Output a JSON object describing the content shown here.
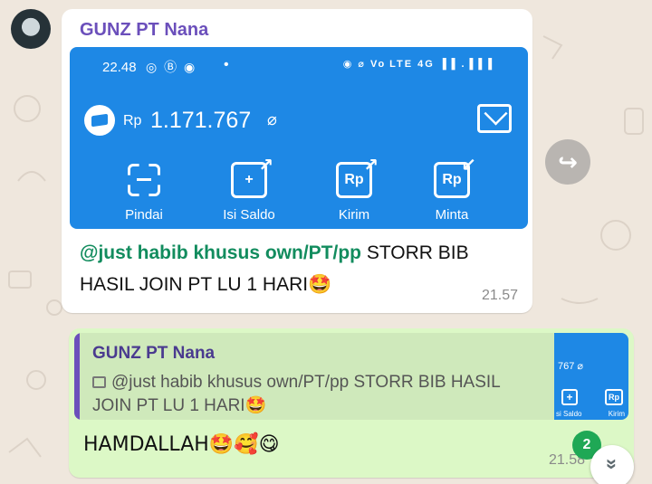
{
  "incoming": {
    "sender": "GUNZ PT Nana",
    "screenshot": {
      "status_time": "22.48",
      "status_left_icons": "◎ Ⓑ ◉",
      "status_dot": "•",
      "status_right_icons": "◉ ⌀ Vo LTE 4G ▐▐ .▐▐ ▌",
      "currency": "Rp",
      "balance": "1.171.767",
      "eye_icon": "⌀",
      "actions": [
        {
          "label": "Pindai",
          "icon": "scan-icon"
        },
        {
          "label": "Isi Saldo",
          "icon": "top-up-icon",
          "glyph": "+"
        },
        {
          "label": "Kirim",
          "icon": "send-money-icon",
          "glyph": "Rp"
        },
        {
          "label": "Minta",
          "icon": "request-money-icon",
          "glyph": "Rp"
        }
      ]
    },
    "mention": "@just habib khusus own/PT/pp",
    "caption_text": " STORR BIB HASIL JOIN PT LU 1 HARI",
    "caption_emoji": "🤩",
    "time": "21.57"
  },
  "outgoing": {
    "quote_sender": "GUNZ PT Nana",
    "quote_text": "@just habib khusus own/PT/pp STORR BIB HASIL JOIN PT LU 1 HARI🤩",
    "thumb": {
      "balance": "767 ⌀",
      "label1": "si Saldo",
      "label2": "Kirim",
      "glyph1": "+",
      "glyph2": "Rp"
    },
    "text": "HAMDALLAH🤩🥰😋",
    "time": "21.58"
  },
  "forward_glyph": "↪",
  "unread_count": "2",
  "scroll_glyph": "»"
}
